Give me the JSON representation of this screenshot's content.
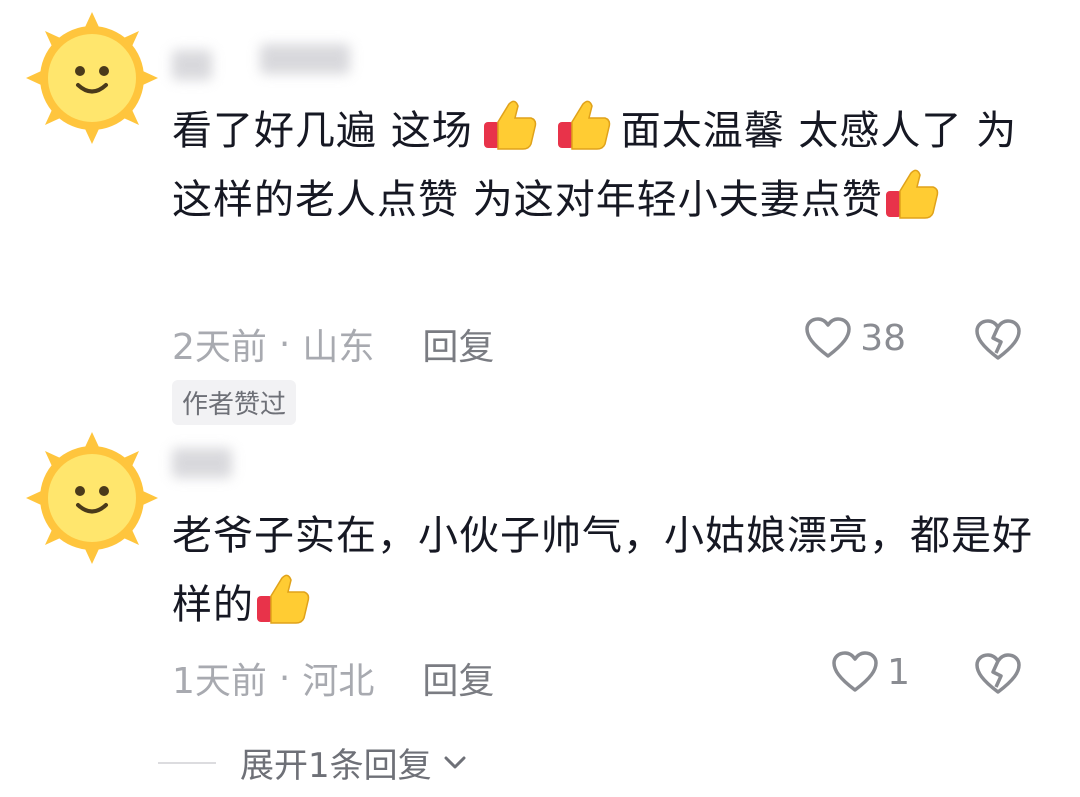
{
  "comments": [
    {
      "text_parts": [
        "看了好几遍 这场",
        "面太温馨 太感人了 为这样的老人点赞 为这对年轻小夫妻点赞"
      ],
      "time": "2天前",
      "location": "山东",
      "reply_label": "回复",
      "likes": "38",
      "author_badge": "作者赞过"
    },
    {
      "text_parts": [
        "老爷子实在，小伙子帅气，小姑娘漂亮，都是好样的"
      ],
      "time": "1天前",
      "location": "河北",
      "reply_label": "回复",
      "likes": "1"
    }
  ],
  "expand_label": "展开1条回复",
  "meta_separator": "·",
  "icons": {
    "avatar": "sun-smile-icon",
    "emoji": "thumbs-up-icon",
    "like": "heart-outline-icon",
    "dislike": "broken-heart-icon",
    "expand": "chevron-down-icon"
  },
  "colors": {
    "text": "#161823",
    "meta": "#a8aab0",
    "sun": "#FFC53D",
    "sun_face": "#FFE66D"
  }
}
